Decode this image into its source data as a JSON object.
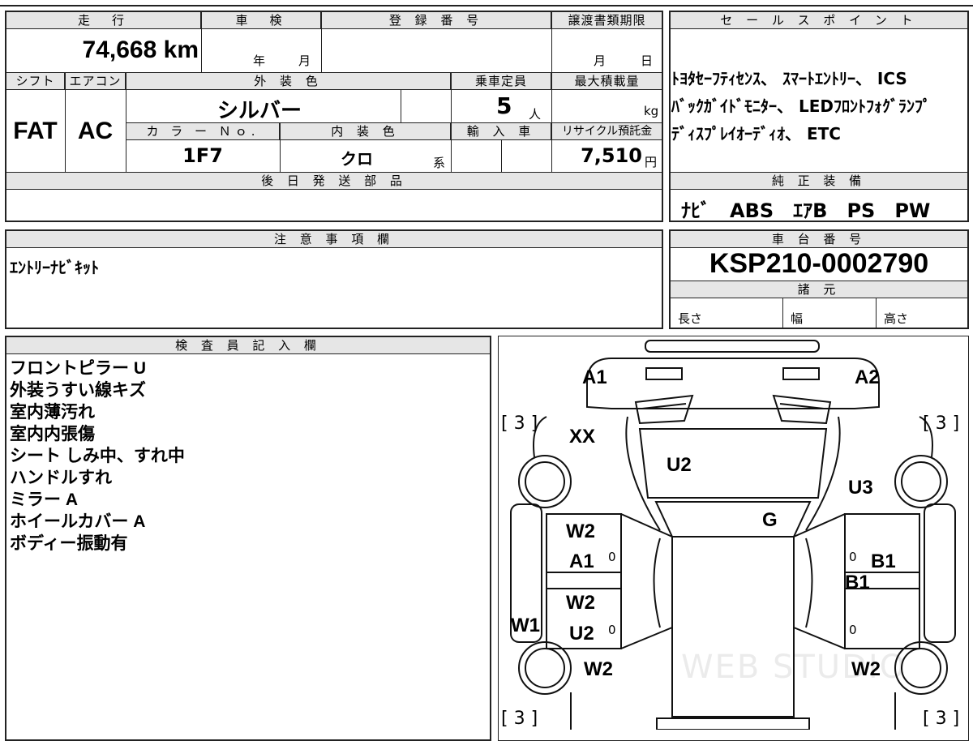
{
  "main": {
    "headers": {
      "mileage": "走　行",
      "inspection": "車　検",
      "registration": "登 録 番 号",
      "deadline": "譲渡書類期限",
      "sales_point": "セ ー ル ス ポ イ ン ト"
    },
    "mileage_value": "74,668 km",
    "inspection_year": "年",
    "inspection_month": "月",
    "deadline_month": "月",
    "deadline_day": "日",
    "row2_headers": {
      "shift": "シフト",
      "aircon": "エアコン",
      "exterior_color": "外 装 色",
      "capacity": "乗車定員",
      "max_load": "最大積載量"
    },
    "shift": "FAT",
    "aircon": "AC",
    "exterior_color": "シルバー",
    "capacity": "5",
    "capacity_unit": "人",
    "load_unit": "kg",
    "row3_headers": {
      "color_no": "カ ラ ー Ｎｏ.",
      "interior_color": "内 装 色",
      "import": "輸 入 車",
      "recycle": "リサイクル預託金"
    },
    "color_no": "1F7",
    "interior_color": "クロ",
    "interior_suffix": "系",
    "recycle_fee": "7,510",
    "recycle_unit": "円",
    "later_parts_header": "後 日 発 送 部 品"
  },
  "sales_points": [
    "ﾄﾖﾀｾｰﾌﾃｨｾﾝｽ、 ｽﾏｰﾄｴﾝﾄﾘｰ、 ICS",
    "ﾊﾞｯｸｶﾞｲﾄﾞﾓﾆﾀｰ、 LEDﾌﾛﾝﾄﾌｫｸﾞﾗﾝﾌﾟ",
    "ﾃﾞｨｽﾌﾟﾚｲｵｰﾃﾞｨｵ、 ETC"
  ],
  "genuine": {
    "header": "純 正 装 備",
    "items": "ﾅﾋﾞ　ABS　ｴｱB　PS　PW"
  },
  "notes": {
    "header": "注 意 事 項 欄",
    "text": "ｴﾝﾄﾘｰﾅﾋﾞｷｯﾄ"
  },
  "chassis": {
    "header": "車 台 番 号",
    "number": "KSP210-0002790",
    "specs_header": "諸 元",
    "length": "長さ",
    "width": "幅",
    "height": "高さ"
  },
  "inspector": {
    "header": "検 査 員 記 入 欄",
    "lines": [
      "フロントピラー U",
      "外装うすい線キズ",
      "室内薄汚れ",
      "室内内張傷",
      "シート しみ中、すれ中",
      "ハンドルすれ",
      "ミラー A",
      "ホイールカバー A",
      "ボディー振動有"
    ]
  },
  "diagram": {
    "labels": {
      "a1_top": "A1",
      "a2_top": "A2",
      "xx": "XX",
      "u2_hood": "U2",
      "u3": "U3",
      "g": "G",
      "w2_left_front": "W2",
      "a1_left": "A1",
      "w2_left_rear": "W2",
      "u2_left": "U2",
      "w1": "W1",
      "w2_bl": "W2",
      "b1_right": "B1",
      "b1_right2": "B1",
      "w2_br": "W2"
    },
    "zeros": [
      "0",
      "0",
      "0",
      "0"
    ],
    "bracket_tl": "[ 3 ]",
    "bracket_tr": "[ 3 ]",
    "bracket_bl": "[ 3 ]",
    "bracket_br": "[ 3 ]",
    "watermark": "WEB STUDIO"
  }
}
